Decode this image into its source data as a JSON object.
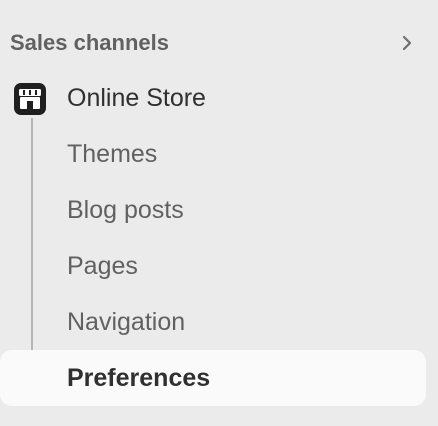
{
  "sales_channels": {
    "title": "Sales channels"
  },
  "online_store": {
    "label": "Online Store"
  },
  "subitems": [
    {
      "label": "Themes"
    },
    {
      "label": "Blog posts"
    },
    {
      "label": "Pages"
    },
    {
      "label": "Navigation"
    },
    {
      "label": "Preferences",
      "active": true
    }
  ],
  "icons": {
    "header_chevron": "chevron-right-icon",
    "store": "store-icon",
    "tree_arrow": "tree-connector-arrow-icon"
  },
  "colors": {
    "background": "#ebebeb",
    "active_item_background": "#fafafa",
    "primary_text": "#303030",
    "secondary_text": "#616161",
    "tree_line": "#b5b5b5"
  }
}
